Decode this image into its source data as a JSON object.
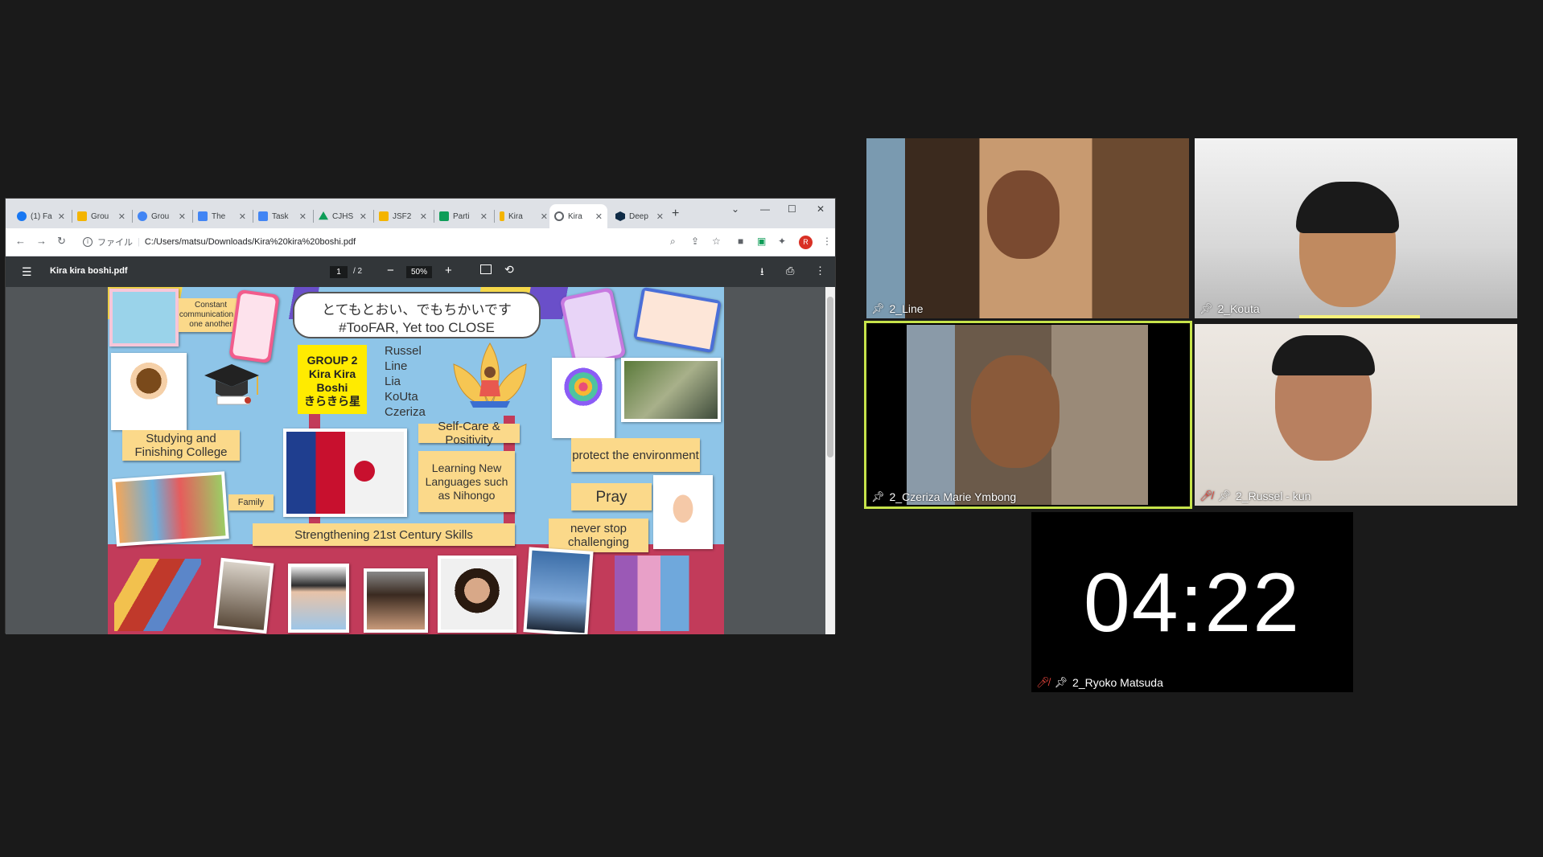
{
  "browser": {
    "tabs": [
      {
        "title": "(1) Fa",
        "icon": "facebook-icon",
        "color": "#1877f2"
      },
      {
        "title": "Grou",
        "icon": "slides-icon",
        "color": "#f4b400"
      },
      {
        "title": "Grou",
        "icon": "chrome-icon",
        "color": "#4285f4"
      },
      {
        "title": "The",
        "icon": "calendar-icon",
        "color": "#4285f4"
      },
      {
        "title": "Task",
        "icon": "docs-icon",
        "color": "#4285f4"
      },
      {
        "title": "CJHS",
        "icon": "drive-icon",
        "color": "#0f9d58"
      },
      {
        "title": "JSF2",
        "icon": "slides-icon",
        "color": "#f4b400"
      },
      {
        "title": "Parti",
        "icon": "sheets-icon",
        "color": "#0f9d58"
      },
      {
        "title": "Kira",
        "icon": "pen-icon",
        "color": "#f4b400"
      },
      {
        "title": "Kira",
        "icon": "globe-icon",
        "color": "#5f6368"
      },
      {
        "title": "Deep",
        "icon": "deepl-icon",
        "color": "#0f2b46"
      }
    ],
    "url_scheme": "ファイル",
    "url": "C:/Users/matsu/Downloads/Kira%20kira%20boshi.pdf",
    "profile_initial": "R"
  },
  "pdf": {
    "filename": "Kira kira boshi.pdf",
    "current_page": "1",
    "page_count": "/  2",
    "zoom": "50%"
  },
  "poster": {
    "title_jp": "とてもとおい、でもちかいです",
    "title_en": "#TooFAR, Yet too CLOSE",
    "group_line1": "GROUP 2",
    "group_line2": "Kira Kira",
    "group_line3": "Boshi",
    "group_line4": "きらきら星",
    "members": [
      "Russel",
      "Line",
      "Lia",
      "KoUta",
      "Czeriza"
    ],
    "labels": {
      "communication": "Constant communication to one another",
      "studying": "Studying and Finishing College",
      "selfcare": "Self-Care & Positivity",
      "environment": "protect the environment",
      "languages": "Learning New Languages such as Nihongo",
      "pray": "Pray",
      "family": "Family",
      "never_stop": "never stop challenging",
      "skills": "Strengthening 21st Century Skills"
    }
  },
  "participants": [
    {
      "name": "2_Line",
      "muted": false
    },
    {
      "name": "2_Kouta",
      "muted": false
    },
    {
      "name": "2_Czeriza Marie Ymbong",
      "muted": false,
      "active_speaker": true
    },
    {
      "name": "2_Russel - kun",
      "muted": true
    },
    {
      "name": "2_Ryoko Matsuda",
      "muted": true
    }
  ],
  "timer": "04:22"
}
